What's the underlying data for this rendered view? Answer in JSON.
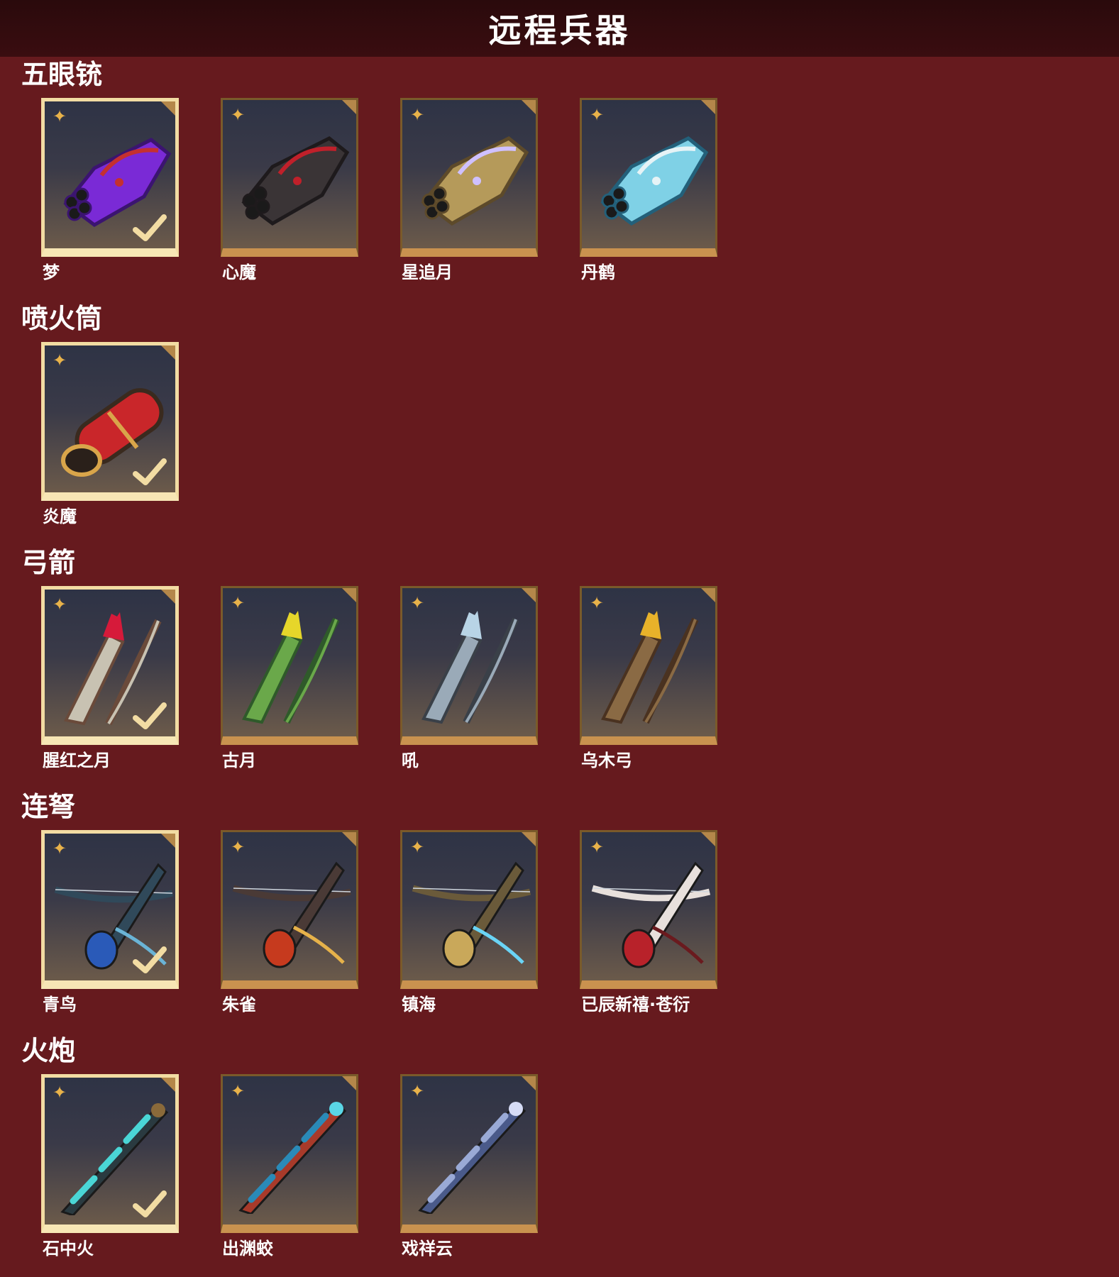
{
  "page": {
    "title": "远程兵器"
  },
  "colors": {
    "background": "#661a1e",
    "header": "#2a0a0c",
    "card_gold": "#c9924f",
    "selected_border": "#f2dca3",
    "star": "#e8b24a"
  },
  "sections": [
    {
      "title": "五眼铳",
      "items": [
        {
          "name": "梦",
          "selected": true,
          "icon": "purple-hand-cannon"
        },
        {
          "name": "心魔",
          "selected": false,
          "icon": "dark-red-hand-cannon"
        },
        {
          "name": "星追月",
          "selected": false,
          "icon": "gold-hand-cannon"
        },
        {
          "name": "丹鹤",
          "selected": false,
          "icon": "cyan-hand-cannon"
        }
      ]
    },
    {
      "title": "喷火筒",
      "items": [
        {
          "name": "炎魔",
          "selected": true,
          "icon": "red-flamethrower"
        }
      ]
    },
    {
      "title": "弓箭",
      "items": [
        {
          "name": "腥红之月",
          "selected": true,
          "icon": "red-bow-quiver"
        },
        {
          "name": "古月",
          "selected": false,
          "icon": "green-bow-quiver"
        },
        {
          "name": "吼",
          "selected": false,
          "icon": "grey-bow-quiver"
        },
        {
          "name": "乌木弓",
          "selected": false,
          "icon": "wooden-bow-quiver"
        }
      ]
    },
    {
      "title": "连弩",
      "items": [
        {
          "name": "青鸟",
          "selected": true,
          "icon": "blue-crossbow"
        },
        {
          "name": "朱雀",
          "selected": false,
          "icon": "red-crossbow"
        },
        {
          "name": "镇海",
          "selected": false,
          "icon": "gold-crossbow"
        },
        {
          "name": "已辰新禧·苍衍",
          "selected": false,
          "icon": "red-white-crossbow"
        }
      ]
    },
    {
      "title": "火炮",
      "items": [
        {
          "name": "石中火",
          "selected": true,
          "icon": "teal-cannon"
        },
        {
          "name": "出渊蛟",
          "selected": false,
          "icon": "blue-red-cannon"
        },
        {
          "name": "戏祥云",
          "selected": false,
          "icon": "silver-cannon"
        }
      ]
    }
  ]
}
